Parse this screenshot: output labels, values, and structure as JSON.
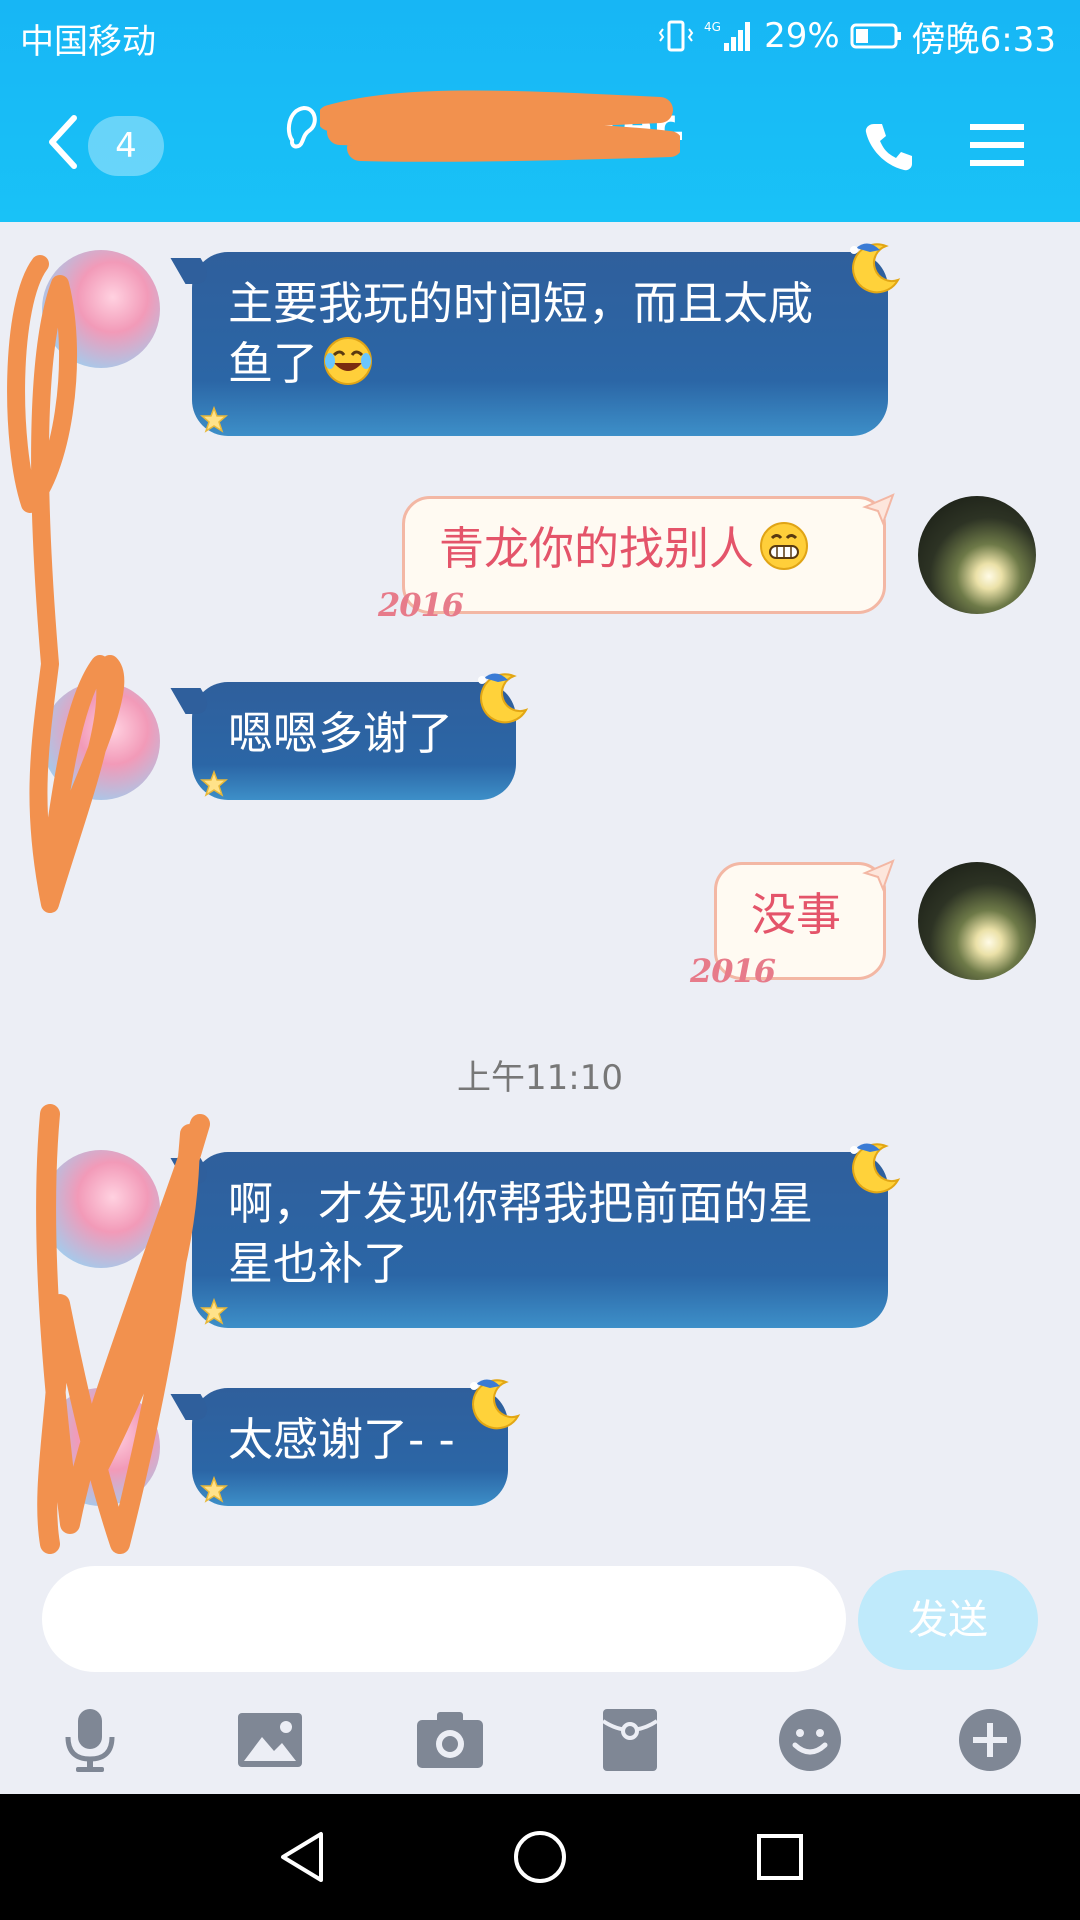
{
  "status_bar": {
    "carrier": "中国移动",
    "network": "4G",
    "battery": "29%",
    "time": "傍晚6:33"
  },
  "header": {
    "back_count": "4",
    "title": "writer.",
    "accent": "#19bff6"
  },
  "messages": [
    {
      "side": "in",
      "text": "主要我玩的时间短，而且太咸鱼了",
      "emoji": "laughing-crying-emoji"
    },
    {
      "side": "out",
      "text": "青龙你的找别人",
      "emoji": "grinning-emoji",
      "tag": "2016"
    },
    {
      "side": "in",
      "text": "嗯嗯多谢了"
    },
    {
      "side": "out",
      "text": "没事",
      "tag": "2016"
    },
    {
      "side": "in",
      "text": "啊，才发现你帮我把前面的星星也补了"
    },
    {
      "side": "in",
      "text": "太感谢了- -"
    }
  ],
  "timestamp": "上午11:10",
  "composer": {
    "input_value": "",
    "send_label": "发送"
  },
  "toolbar": [
    "microphone-icon",
    "image-icon",
    "camera-icon",
    "red-packet-icon",
    "emoji-icon",
    "plus-icon"
  ],
  "nav": [
    "back-triangle-icon",
    "home-circle-icon",
    "recents-square-icon"
  ]
}
